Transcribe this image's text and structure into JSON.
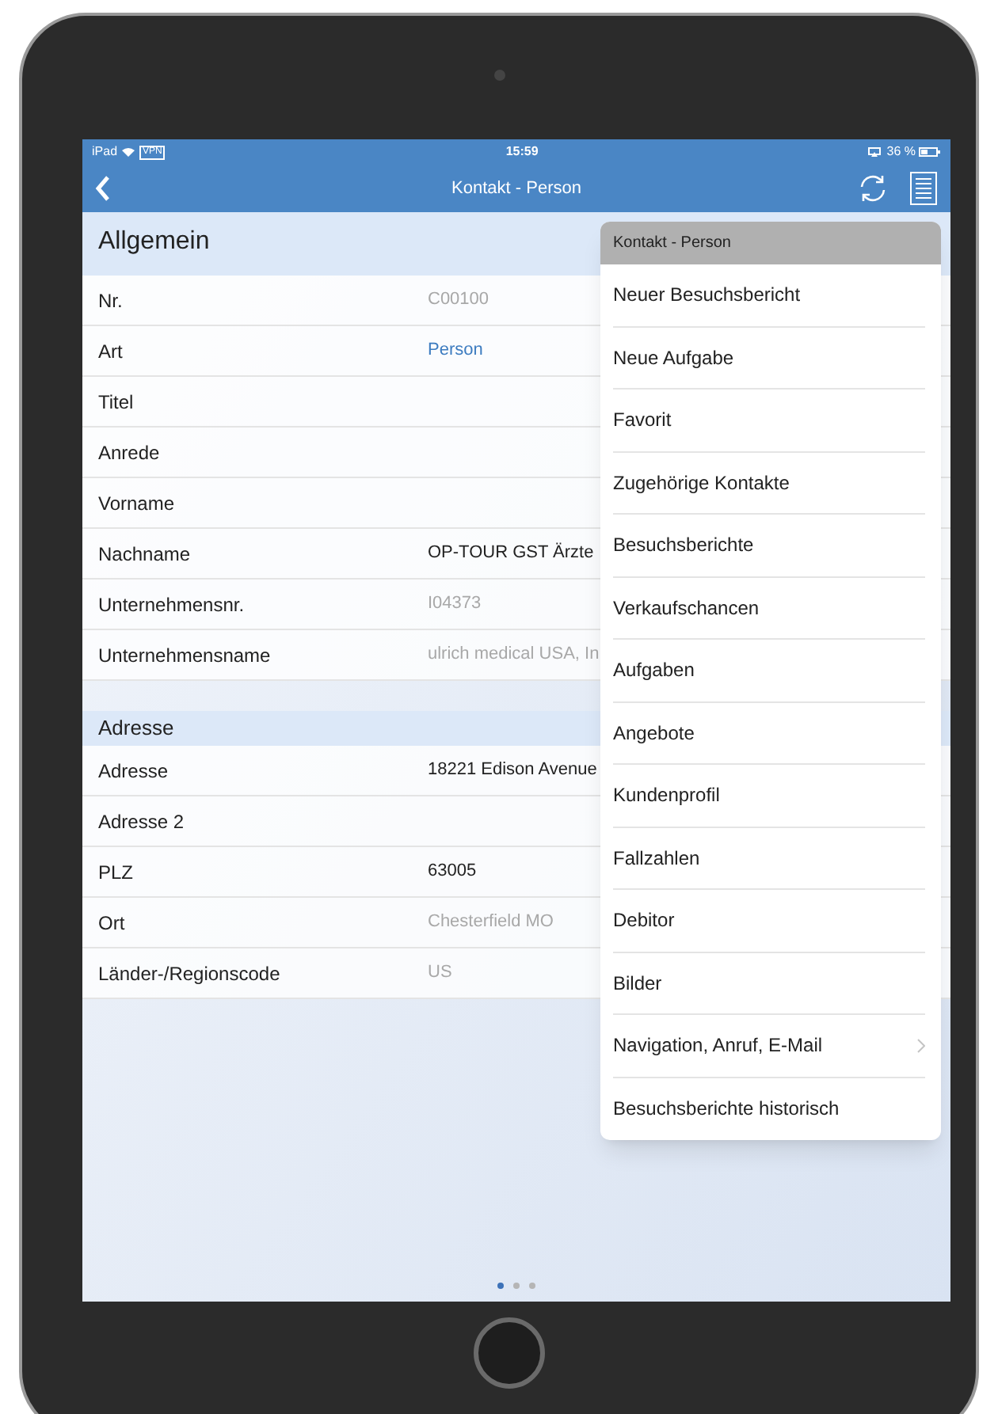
{
  "status_bar": {
    "device": "iPad",
    "vpn": "VPN",
    "time": "15:59",
    "battery": "36 %"
  },
  "nav_bar": {
    "title": "Kontakt - Person"
  },
  "sections": [
    {
      "title": "Allgemein",
      "fields": [
        {
          "label": "Nr.",
          "value": "C00100",
          "kind": "readonly"
        },
        {
          "label": "Art",
          "value": "Person",
          "kind": "link"
        },
        {
          "label": "Titel"
        },
        {
          "label": "Anrede"
        },
        {
          "label": "Vorname"
        },
        {
          "label": "Nachname",
          "value": "OP-TOUR GST Ärzte",
          "kind": "editable"
        },
        {
          "label": "Unternehmensnr.",
          "value": "I04373",
          "kind": "readonly"
        },
        {
          "label": "Unternehmensname",
          "value": "ulrich medical USA, In",
          "kind": "readonly"
        }
      ]
    },
    {
      "title": "Adresse",
      "fields": [
        {
          "label": "Adresse",
          "value": "18221 Edison Avenue",
          "kind": "editable"
        },
        {
          "label": "Adresse 2"
        },
        {
          "label": "PLZ",
          "value": "63005",
          "kind": "editable"
        },
        {
          "label": "Ort",
          "value": "Chesterfield MO",
          "kind": "readonly"
        },
        {
          "label": "Länder-/Regionscode",
          "value": "US",
          "kind": "readonly"
        }
      ]
    }
  ],
  "menu": {
    "title": "Kontakt - Person",
    "items": [
      {
        "label": "Neuer Besuchsbericht",
        "submenu": false
      },
      {
        "label": "Neue Aufgabe",
        "submenu": false
      },
      {
        "label": "Favorit",
        "submenu": false
      },
      {
        "label": "Zugehörige Kontakte",
        "submenu": false
      },
      {
        "label": "Besuchsberichte",
        "submenu": false
      },
      {
        "label": "Verkaufschancen",
        "submenu": false
      },
      {
        "label": "Aufgaben",
        "submenu": false
      },
      {
        "label": "Angebote",
        "submenu": false
      },
      {
        "label": "Kundenprofil",
        "submenu": false
      },
      {
        "label": "Fallzahlen",
        "submenu": false
      },
      {
        "label": "Debitor",
        "submenu": false
      },
      {
        "label": "Bilder",
        "submenu": false
      },
      {
        "label": "Navigation, Anruf, E-Mail",
        "submenu": true
      },
      {
        "label": "Besuchsberichte historisch",
        "submenu": false
      }
    ]
  },
  "page_dots": [
    {
      "selected": true
    },
    {
      "selected": false
    },
    {
      "selected": false
    }
  ]
}
